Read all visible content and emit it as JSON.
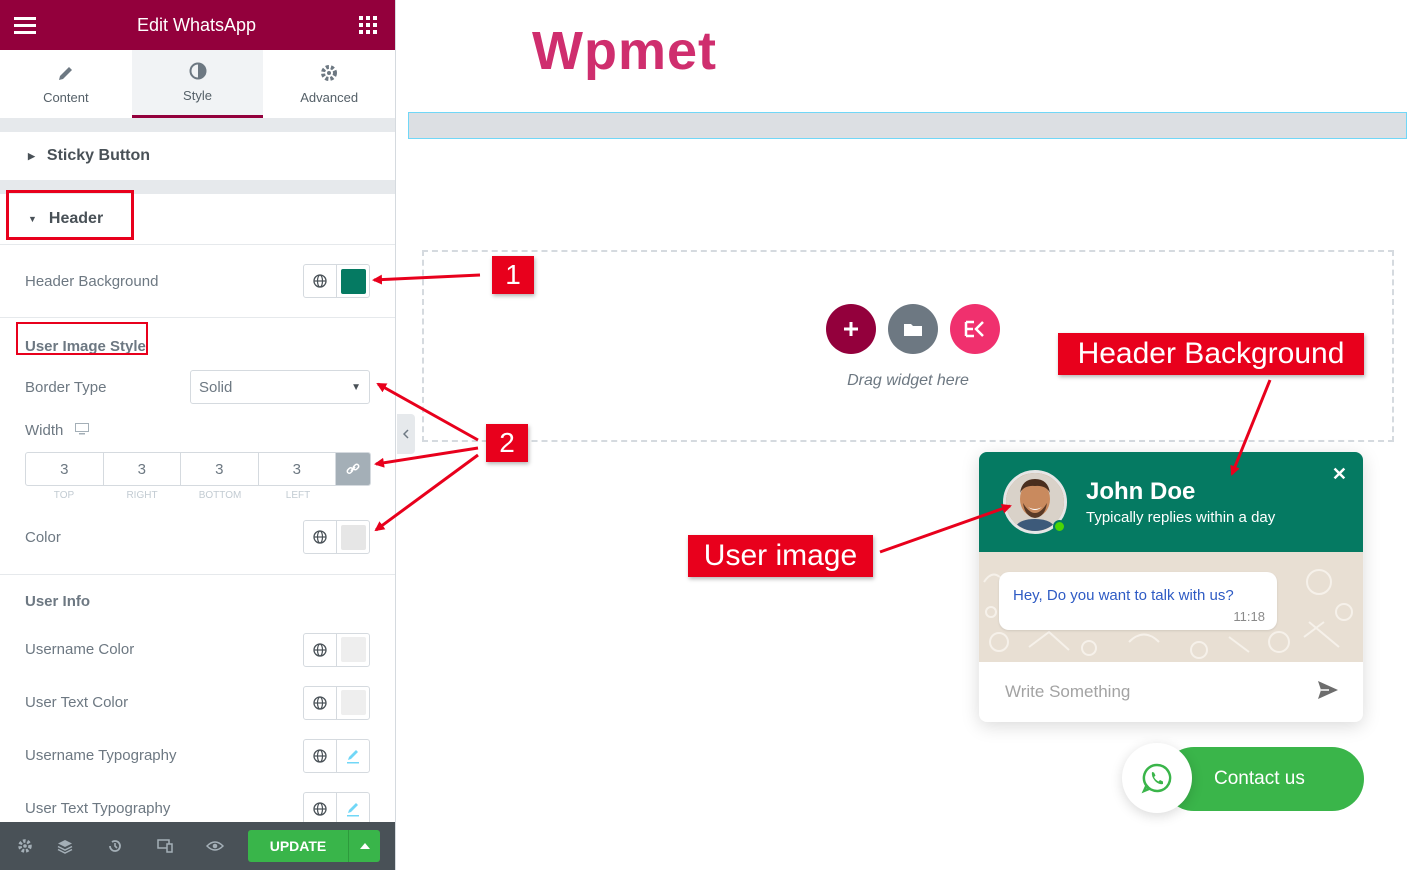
{
  "topbar": {
    "title": "Edit WhatsApp"
  },
  "tabs": [
    {
      "label": "Content"
    },
    {
      "label": "Style"
    },
    {
      "label": "Advanced"
    }
  ],
  "sections": {
    "sticky_button": "Sticky Button",
    "header": "Header"
  },
  "header_section": {
    "header_background_label": "Header Background",
    "header_background_color": "#057a62",
    "user_image_style_label": "User Image Style",
    "border_type_label": "Border Type",
    "border_type_value": "Solid",
    "width_label": "Width",
    "width_values": [
      "3",
      "3",
      "3",
      "3"
    ],
    "width_sides": [
      "TOP",
      "RIGHT",
      "BOTTOM",
      "LEFT"
    ],
    "color_label": "Color",
    "color_value": "#e6e6e6",
    "user_info_label": "User Info",
    "username_color_label": "Username Color",
    "user_text_color_label": "User Text Color",
    "username_typography_label": "Username Typography",
    "user_text_typography_label": "User Text Typography"
  },
  "bottombar": {
    "update_label": "UPDATE"
  },
  "canvas": {
    "logo": "Wpmet",
    "drag_text": "Drag widget here"
  },
  "whatsapp_widget": {
    "name": "John Doe",
    "subtitle": "Typically replies within a day",
    "message": "Hey, Do you want to talk with us?",
    "time": "11:18",
    "input_placeholder": "Write Something",
    "contact_label": "Contact us"
  },
  "annotations": {
    "label_1": "1",
    "label_2": "2",
    "header_background": "Header Background",
    "user_image": "User image"
  },
  "colors": {
    "brand": "#93003c",
    "logo": "#cf2e6e",
    "whatsapp_green": "#3ab54a",
    "header_green": "#057a62",
    "annotation_red": "#e8001c"
  }
}
